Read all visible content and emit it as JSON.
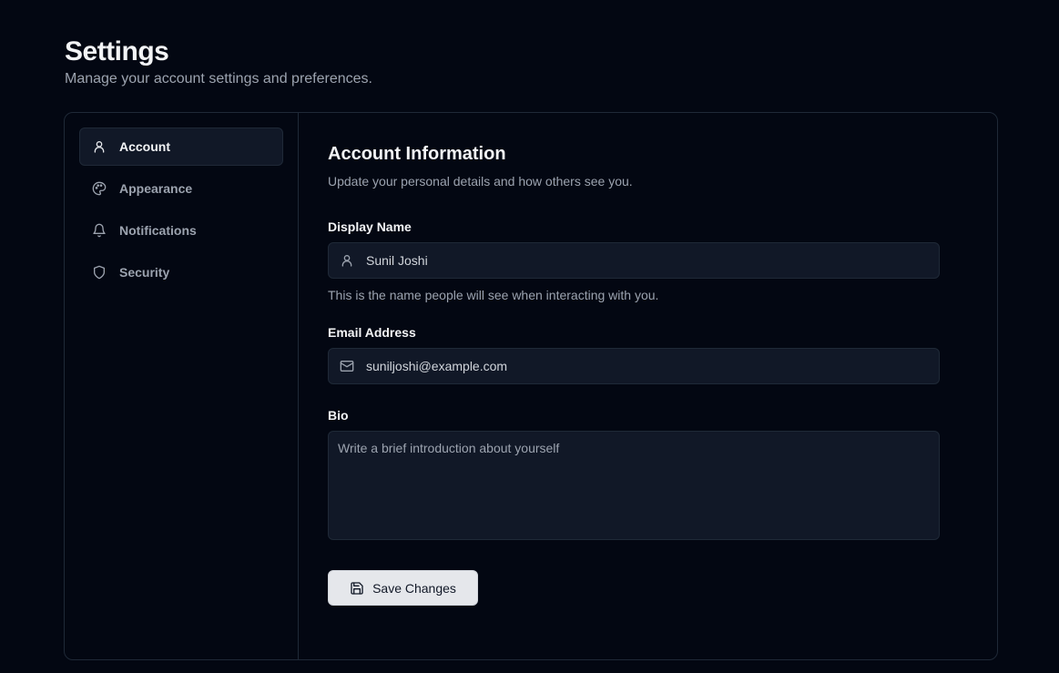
{
  "header": {
    "title": "Settings",
    "subtitle": "Manage your account settings and preferences."
  },
  "sidebar": {
    "items": [
      {
        "label": "Account",
        "icon": "user-icon",
        "active": true
      },
      {
        "label": "Appearance",
        "icon": "palette-icon",
        "active": false
      },
      {
        "label": "Notifications",
        "icon": "bell-icon",
        "active": false
      },
      {
        "label": "Security",
        "icon": "shield-icon",
        "active": false
      }
    ]
  },
  "account": {
    "title": "Account Information",
    "description": "Update your personal details and how others see you.",
    "display_name": {
      "label": "Display Name",
      "value": "Sunil Joshi",
      "icon": "user-icon",
      "helper": "This is the name people will see when interacting with you."
    },
    "email": {
      "label": "Email Address",
      "value": "suniljoshi@example.com",
      "icon": "mail-icon"
    },
    "bio": {
      "label": "Bio",
      "value": "",
      "placeholder": "Write a brief introduction about yourself"
    },
    "save_label": "Save Changes",
    "save_icon": "save-icon"
  },
  "colors": {
    "background": "#030712",
    "surface": "#111827",
    "border": "#1f2937",
    "text": "#f3f4f6",
    "muted": "#9ca3af",
    "button": "#e5e7eb"
  }
}
